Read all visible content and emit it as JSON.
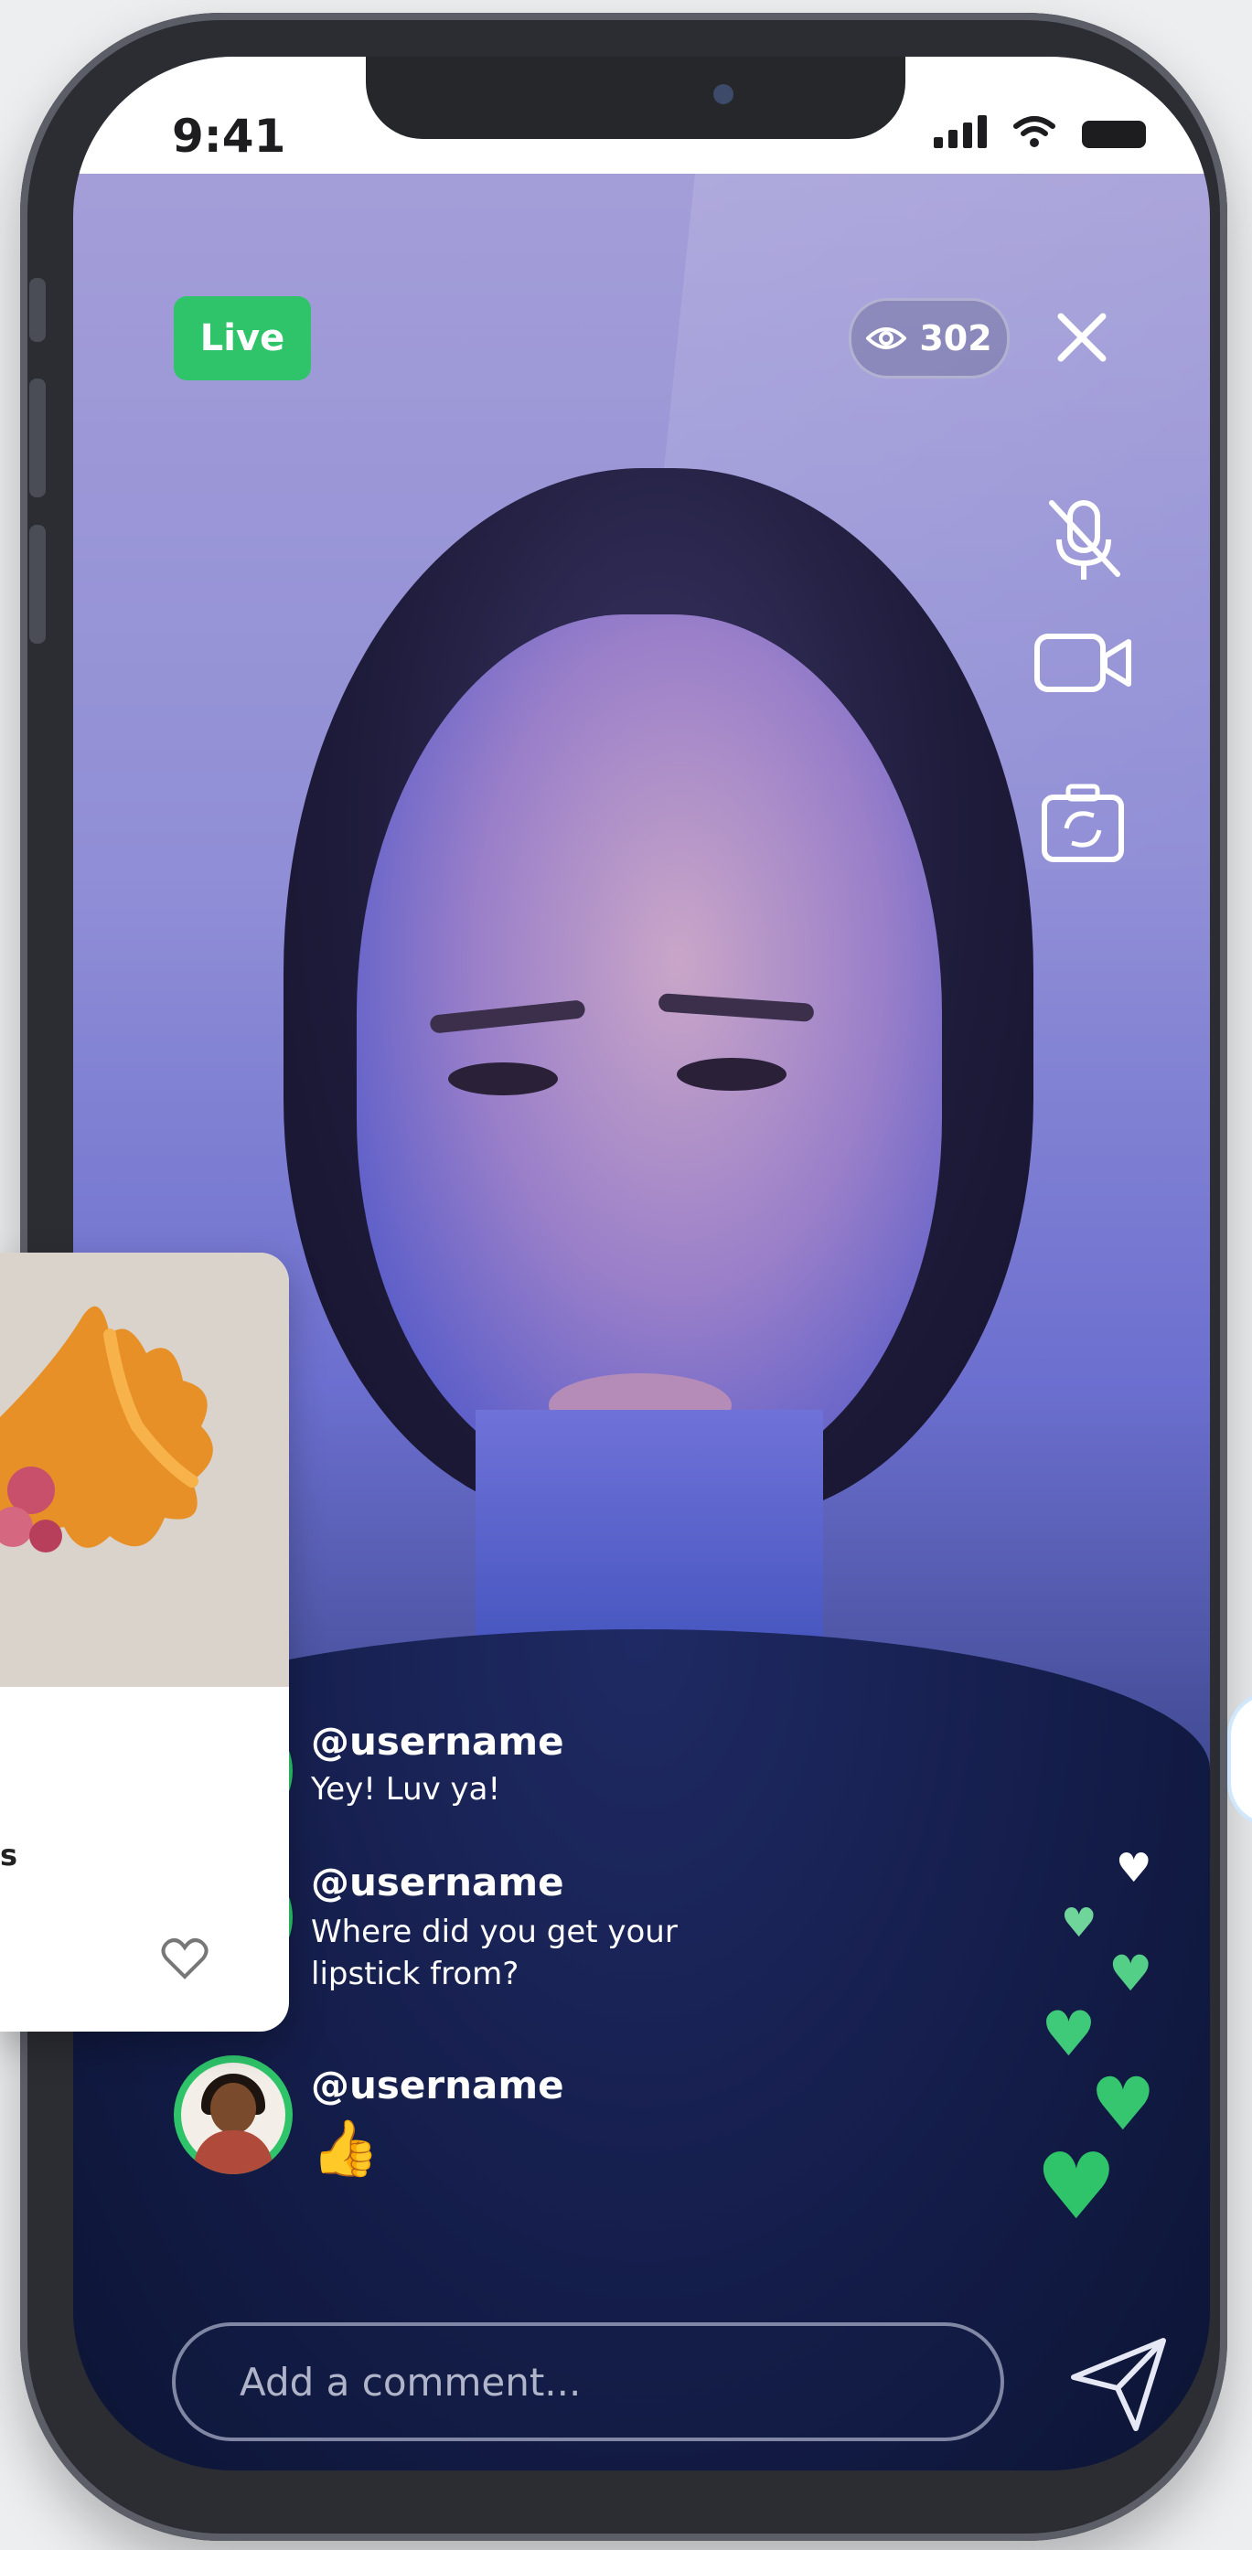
{
  "status_bar": {
    "time": "9:41"
  },
  "stream": {
    "live_label": "Live",
    "viewer_count": "302"
  },
  "controls": {
    "icons": [
      "eye-icon",
      "close-icon",
      "mic-off-icon",
      "video-camera-icon",
      "camera-flip-icon",
      "send-icon",
      "heart-icon"
    ]
  },
  "comments": [
    {
      "username": "@username",
      "text": "Yey! Luv ya!"
    },
    {
      "username": "@username",
      "text": "Where did you get your lipstick from?"
    },
    {
      "username": "@username",
      "text": "👍"
    }
  ],
  "comment_input": {
    "placeholder": "Add a comment..."
  },
  "product_card": {
    "partial_text": "s"
  },
  "colors": {
    "accent_green": "#2fc46a",
    "background": "#eceef0"
  }
}
